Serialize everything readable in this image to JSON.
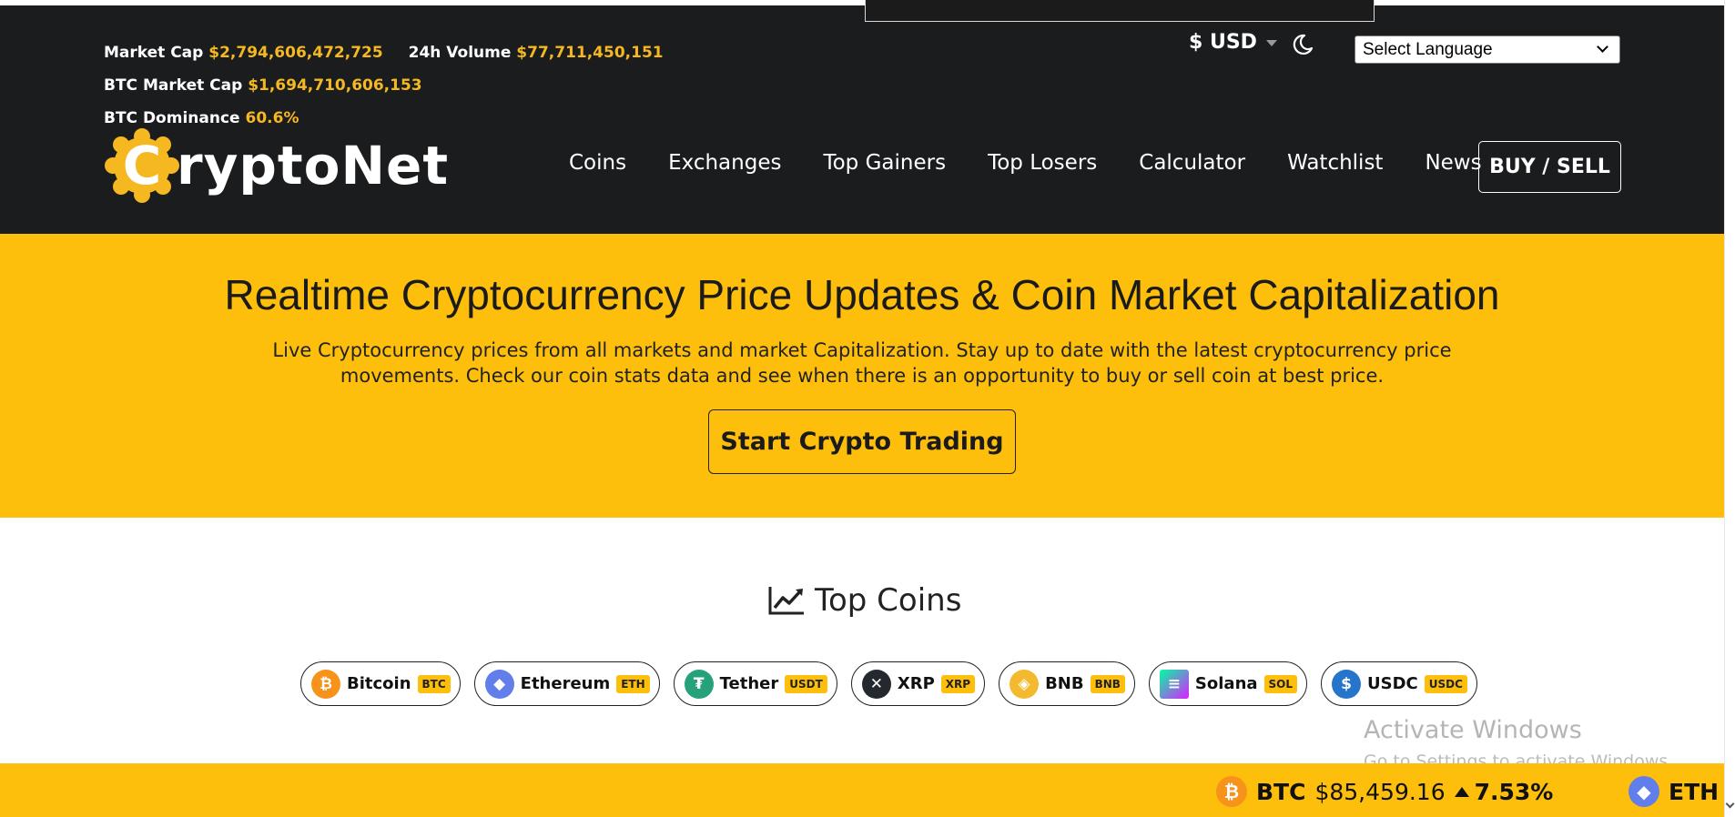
{
  "stats": [
    {
      "label": "Market Cap",
      "value": "$2,794,606,472,725"
    },
    {
      "label": "24h Volume",
      "value": "$77,711,450,151"
    },
    {
      "label": "BTC Market Cap",
      "value": "$1,694,710,606,153"
    },
    {
      "label": "BTC Dominance",
      "value": "60.6%"
    }
  ],
  "currency": "$ USD",
  "language_select": "Select Language",
  "logo_text": "ryptoNet",
  "logo_initial": "C",
  "nav": [
    "Coins",
    "Exchanges",
    "Top Gainers",
    "Top Losers",
    "Calculator",
    "Watchlist",
    "News"
  ],
  "buy_sell": "BUY / SELL",
  "hero": {
    "title": "Realtime Cryptocurrency Price Updates & Coin Market Capitalization",
    "description": "Live Cryptocurrency prices from all markets and market Capitalization. Stay up to date with the latest cryptocurrency price movements. Check our coin stats data and see when there is an opportunity to buy or sell coin at best price.",
    "cta": "Start Crypto Trading"
  },
  "top_coins": {
    "title": "Top Coins",
    "items": [
      {
        "name": "Bitcoin",
        "symbol": "BTC",
        "color": "#f7931a",
        "glyph": "₿"
      },
      {
        "name": "Ethereum",
        "symbol": "ETH",
        "color": "#627eea",
        "glyph": "◆"
      },
      {
        "name": "Tether",
        "symbol": "USDT",
        "color": "#26a17b",
        "glyph": "₮"
      },
      {
        "name": "XRP",
        "symbol": "XRP",
        "color": "#23292f",
        "glyph": "✕"
      },
      {
        "name": "BNB",
        "symbol": "BNB",
        "color": "#f3ba2f",
        "glyph": "◈"
      },
      {
        "name": "Solana",
        "symbol": "SOL",
        "color": "#000000",
        "glyph": "≡"
      },
      {
        "name": "USDC",
        "symbol": "USDC",
        "color": "#2775ca",
        "glyph": "$"
      }
    ]
  },
  "ticker": [
    {
      "symbol": "BTC",
      "price": "$85,459.16",
      "change": "7.53%",
      "color": "#f7931a",
      "glyph": "₿"
    },
    {
      "symbol": "ETH",
      "color": "#627eea",
      "glyph": "◆"
    }
  ],
  "watermark": {
    "line1": "Activate Windows",
    "line2": "Go to Settings to activate Windows."
  }
}
